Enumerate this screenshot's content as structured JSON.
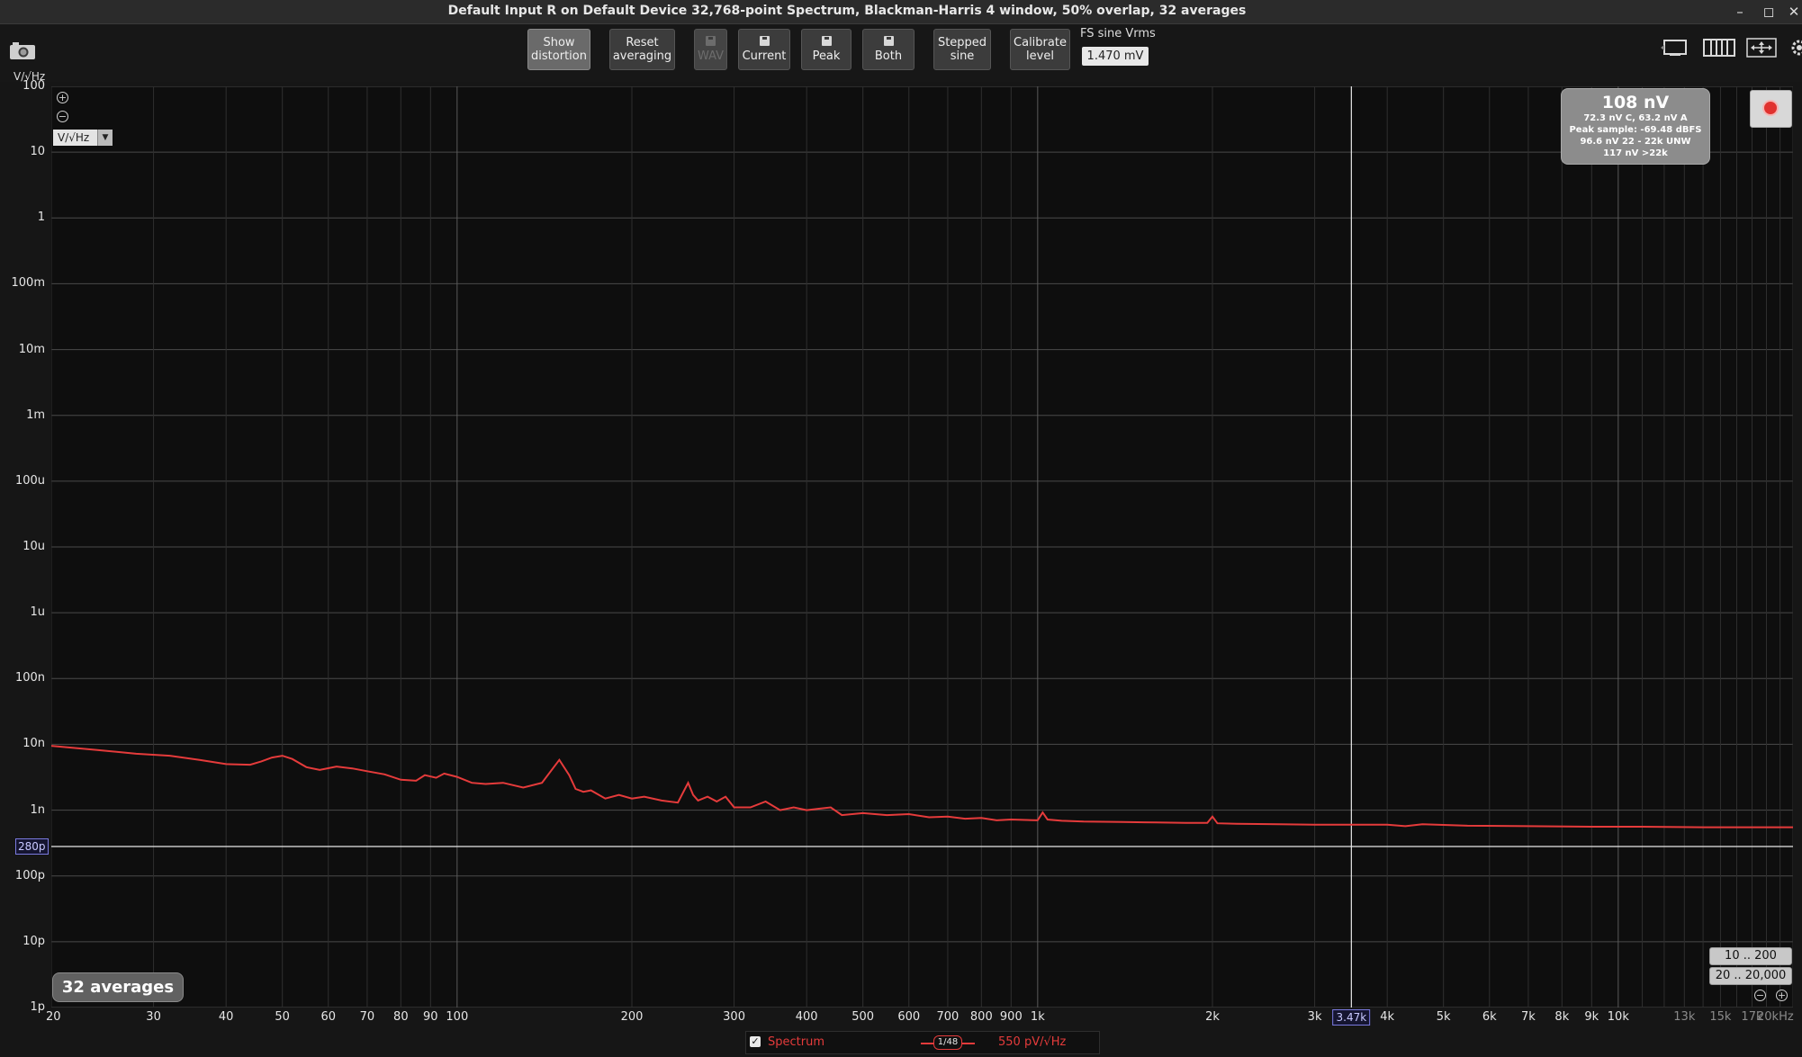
{
  "window": {
    "title": "Default Input R on Default Device 32,768-point Spectrum, Blackman-Harris 4 window, 50% overlap, 32 averages"
  },
  "toolbar": {
    "show_distortion": [
      "Show",
      "distortion"
    ],
    "reset_averaging": [
      "Reset",
      "averaging"
    ],
    "wav": "WAV",
    "current": "Current",
    "peak": "Peak",
    "both": "Both",
    "stepped_sine": [
      "Stepped",
      "sine"
    ],
    "calibrate_level": [
      "Calibrate",
      "level"
    ],
    "fs_sine_label": "FS sine Vrms",
    "fs_sine_value": "1.470 mV"
  },
  "unit_label": "V/√Hz",
  "unit_select": "V/√Hz",
  "info": {
    "main": "108 nV",
    "line1": "72.3 nV C, 63.2 nV A",
    "line2": "Peak sample: -69.48 dBFS",
    "line3": "96.6 nV 22 - 22k UNW",
    "line4": "117 nV >22k"
  },
  "averages_badge": "32 averages",
  "range_buttons": [
    "10 .. 200",
    "20 .. 20,000"
  ],
  "markers": {
    "y": "280p",
    "x": "3.47k"
  },
  "legend": {
    "name": "Spectrum",
    "smoothing": "1/48",
    "value": "550 pV/√Hz"
  },
  "colors": {
    "trace": "#e53b3b",
    "marker": "#c8c8ff",
    "grid": "#3a3a3a"
  },
  "chart_data": {
    "type": "line",
    "title": "Default Input R on Default Device 32,768-point Spectrum, Blackman-Harris 4 window, 50% overlap, 32 averages",
    "xlabel": "",
    "ylabel": "V/√Hz",
    "x_scale": "log",
    "y_scale": "log",
    "xlim": [
      20,
      20000
    ],
    "ylim": [
      1e-12,
      100
    ],
    "grid": true,
    "y_ticks": [
      "100",
      "10",
      "1",
      "100m",
      "10m",
      "1m",
      "100u",
      "10u",
      "1u",
      "100n",
      "10n",
      "1n",
      "100p",
      "10p",
      "1p"
    ],
    "x_ticks": [
      "20",
      "30",
      "40",
      "50",
      "60",
      "70",
      "80",
      "90",
      "100",
      "200",
      "300",
      "400",
      "500",
      "600",
      "700",
      "800",
      "900",
      "1k",
      "2k",
      "3k",
      "4k",
      "5k",
      "6k",
      "7k",
      "8k",
      "9k",
      "10k",
      "13k",
      "15k",
      "17k",
      "20kHz"
    ],
    "marker_x": 3470,
    "marker_y": 2.8e-10,
    "series": [
      {
        "name": "Spectrum",
        "x": [
          20,
          24,
          28,
          32,
          36,
          40,
          44,
          46,
          48,
          50,
          52,
          55,
          58,
          62,
          66,
          70,
          75,
          80,
          85,
          88,
          92,
          95,
          100,
          106,
          112,
          120,
          130,
          140,
          150,
          156,
          160,
          165,
          170,
          180,
          190,
          200,
          210,
          225,
          240,
          250,
          255,
          260,
          270,
          280,
          290,
          300,
          320,
          340,
          360,
          380,
          400,
          420,
          440,
          460,
          500,
          550,
          600,
          650,
          700,
          750,
          800,
          850,
          900,
          1000,
          1020,
          1040,
          1100,
          1200,
          1400,
          1600,
          1800,
          1960,
          2000,
          2040,
          2200,
          2600,
          3000,
          3500,
          4000,
          4300,
          4600,
          5500,
          7000,
          9000,
          11000,
          14000,
          17000,
          20000
        ],
        "y": [
          9.5e-09,
          8.2e-09,
          7.2e-09,
          6.7e-09,
          5.8e-09,
          5e-09,
          4.9e-09,
          5.5e-09,
          6.3e-09,
          6.7e-09,
          6e-09,
          4.5e-09,
          4.1e-09,
          4.6e-09,
          4.3e-09,
          3.9e-09,
          3.5e-09,
          2.9e-09,
          2.8e-09,
          3.4e-09,
          3.1e-09,
          3.6e-09,
          3.2e-09,
          2.6e-09,
          2.5e-09,
          2.6e-09,
          2.2e-09,
          2.6e-09,
          5.8e-09,
          3.4e-09,
          2.1e-09,
          1.9e-09,
          2e-09,
          1.5e-09,
          1.7e-09,
          1.5e-09,
          1.6e-09,
          1.4e-09,
          1.3e-09,
          2.6e-09,
          1.7e-09,
          1.4e-09,
          1.6e-09,
          1.35e-09,
          1.6e-09,
          1.1e-09,
          1.1e-09,
          1.35e-09,
          1e-09,
          1.1e-09,
          1e-09,
          1.05e-09,
          1.1e-09,
          8.4e-10,
          9e-10,
          8.4e-10,
          8.7e-10,
          7.8e-10,
          8e-10,
          7.4e-10,
          7.6e-10,
          7e-10,
          7.2e-10,
          7e-10,
          9.2e-10,
          7.2e-10,
          6.9e-10,
          6.7e-10,
          6.6e-10,
          6.5e-10,
          6.4e-10,
          6.4e-10,
          8e-10,
          6.3e-10,
          6.2e-10,
          6.1e-10,
          6e-10,
          6e-10,
          6e-10,
          5.7e-10,
          6.1e-10,
          5.8e-10,
          5.7e-10,
          5.6e-10,
          5.6e-10,
          5.5e-10,
          5.5e-10,
          5.5e-10
        ]
      }
    ]
  }
}
